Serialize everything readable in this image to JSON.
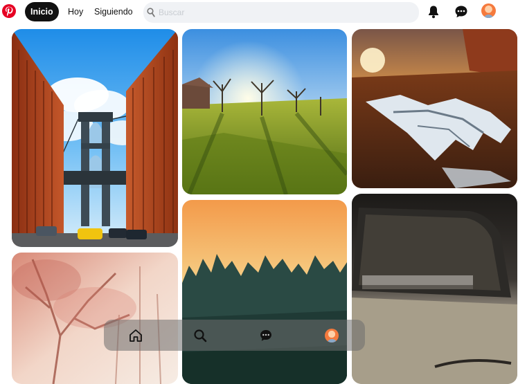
{
  "header": {
    "logo": "pinterest-logo-icon",
    "nav": {
      "home_label": "Inicio",
      "today_label": "Hoy",
      "following_label": "Siguiendo"
    },
    "search": {
      "placeholder": "Buscar",
      "icon": "search-icon"
    },
    "icons": [
      "bell-icon",
      "chat-icon",
      "avatar"
    ]
  },
  "pins": [
    {
      "subject": "manhattan-bridge-brick-buildings"
    },
    {
      "subject": "sunlit-meadow-trees"
    },
    {
      "subject": "sunset-melting-snow-field"
    },
    {
      "subject": "misty-pink-forest"
    },
    {
      "subject": "orange-sky-pine-forest"
    },
    {
      "subject": "vintage-car-window"
    }
  ],
  "bottom_nav": {
    "icons": [
      "home-icon",
      "search-icon",
      "chat-icon",
      "avatar"
    ]
  },
  "colors": {
    "brand": "#e60023",
    "active_pill": "#111111",
    "search_bg": "#f0f2f5"
  }
}
